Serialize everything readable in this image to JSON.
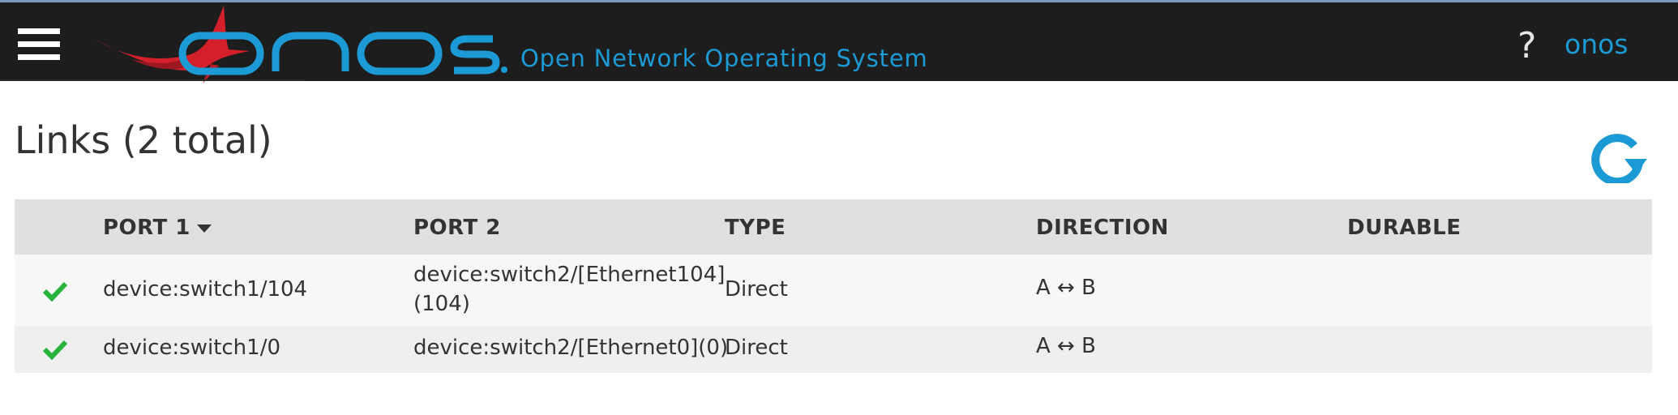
{
  "header": {
    "menu_icon": "hamburger-menu-icon",
    "logo_text": "onos",
    "logo_subtitle": "Open Network Operating System",
    "help_label": "?",
    "user_label": "onos",
    "colors": {
      "bar": "#1e1d1d",
      "brand_blue": "#1c9ad6",
      "bird_red": "#d3202b"
    }
  },
  "page": {
    "title": "Links (2 total)",
    "refresh_icon": "refresh-icon"
  },
  "table": {
    "columns": [
      "PORT 1",
      "PORT 2",
      "TYPE",
      "DIRECTION",
      "DURABLE"
    ],
    "sorted_column": "PORT 1",
    "sort_direction": "descending",
    "rows": [
      {
        "status_icon": "check-icon",
        "status_color": "#27b33c",
        "port1": "device:switch1/104",
        "port2_line1": "device:switch2/[Ethernet104]",
        "port2_line2": "(104)",
        "type": "Direct",
        "direction": "A ↔ B",
        "durable": ""
      },
      {
        "status_icon": "check-icon",
        "status_color": "#27b33c",
        "port1": "device:switch1/0",
        "port2_line1": "device:switch2/[Ethernet0](0)",
        "port2_line2": "",
        "type": "Direct",
        "direction": "A ↔ B",
        "durable": ""
      }
    ]
  }
}
